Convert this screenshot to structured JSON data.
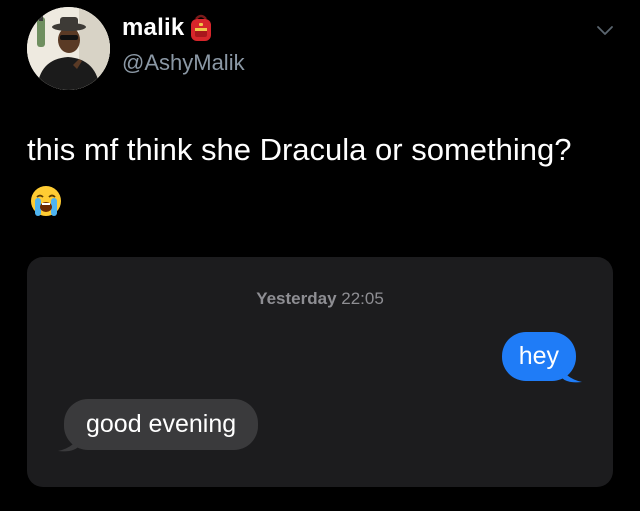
{
  "user": {
    "display_name": "malik",
    "handle": "@AshyMalik",
    "name_emoji": "backpack-emoji"
  },
  "tweet": {
    "text": "this mf think she Dracula or something?",
    "emoji": "loudly-crying-face-emoji"
  },
  "chat": {
    "timestamp_day": "Yesterday",
    "timestamp_time": "22:05",
    "outgoing_message": "hey",
    "incoming_message": "good evening"
  },
  "colors": {
    "background": "#000000",
    "outgoing_bubble": "#1f7cf7",
    "incoming_bubble": "#3a3a3c",
    "chat_background": "#1c1c1e"
  },
  "icons": {
    "more": "chevron-down-icon"
  }
}
